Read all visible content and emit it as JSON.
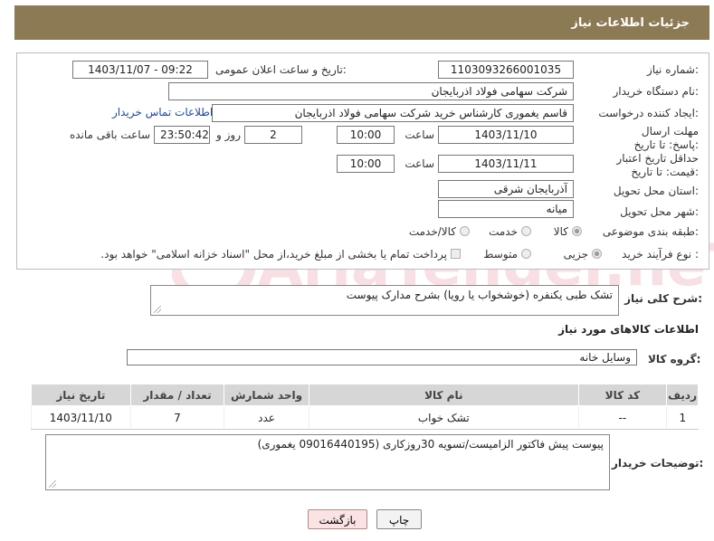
{
  "header": {
    "title": "جزئیات اطلاعات نیاز"
  },
  "form": {
    "need_number_label": "شماره نیاز:",
    "need_number": "1103093266001035",
    "announce_label": "تاریخ و ساعت اعلان عمومی:",
    "announce_value": "1403/11/07 - 09:22",
    "buyer_org_label": "نام دستگاه خریدار:",
    "buyer_org": "شرکت سهامی فولاد اذربایجان",
    "creator_label": "ایجاد کننده درخواست:",
    "creator": "قاسم یغموری کارشناس خرید شرکت سهامی فولاد اذربایجان",
    "contact_link": "اطلاعات تماس خریدار",
    "reply_deadline_label": "مهلت ارسال پاسخ: تا تاریخ:",
    "reply_date": "1403/11/10",
    "time_label": "ساعت",
    "reply_time": "10:00",
    "days_value": "2",
    "days_label": "روز و",
    "remaining_time": "23:50:42",
    "remaining_label": "ساعت باقی مانده",
    "price_validity_label": "حداقل تاریخ اعتبار قیمت: تا تاریخ:",
    "price_date": "1403/11/11",
    "price_time": "10:00",
    "province_label": "استان محل تحویل:",
    "province": "آذربایجان شرقی",
    "city_label": "شهر محل تحویل:",
    "city": "میانه",
    "category_label": "طبقه بندی موضوعی:",
    "category_options": [
      "کالا",
      "خدمت",
      "کالا/خدمت"
    ],
    "process_label": "نوع فرآیند خرید :",
    "process_options": [
      "جزیی",
      "متوسط"
    ],
    "payment_note": "پرداخت تمام یا بخشی از مبلغ خرید،از محل \"اسناد خزانه اسلامی\" خواهد بود."
  },
  "description": {
    "label": "شرح کلی نیاز:",
    "value": "تشک طبی یکنفره (خوشخواب یا رویا) بشرح مدارک پیوست"
  },
  "goods": {
    "section_title": "اطلاعات کالاهای مورد نیاز",
    "group_label": "گروه کالا:",
    "group_value": "وسایل خانه",
    "columns": [
      "ردیف",
      "کد کالا",
      "نام کالا",
      "واحد شمارش",
      "تعداد / مقدار",
      "تاریخ نیاز"
    ],
    "rows": [
      [
        "1",
        "--",
        "تشک خواب",
        "عدد",
        "7",
        "1403/11/10"
      ]
    ]
  },
  "buyer_notes": {
    "label": "توضیحات خریدار:",
    "value": "پیوست پیش فاکتور الزامیست/تسویه 30روزکاری (09016440195 یغموری)"
  },
  "buttons": {
    "print": "چاپ",
    "back": "بازگشت"
  },
  "watermark": {
    "text": "AriaTender.neT"
  },
  "colors": {
    "header_bg": "#8c7a55",
    "link": "#1b4aa8",
    "back_button_bg": "#fbe3e3"
  }
}
